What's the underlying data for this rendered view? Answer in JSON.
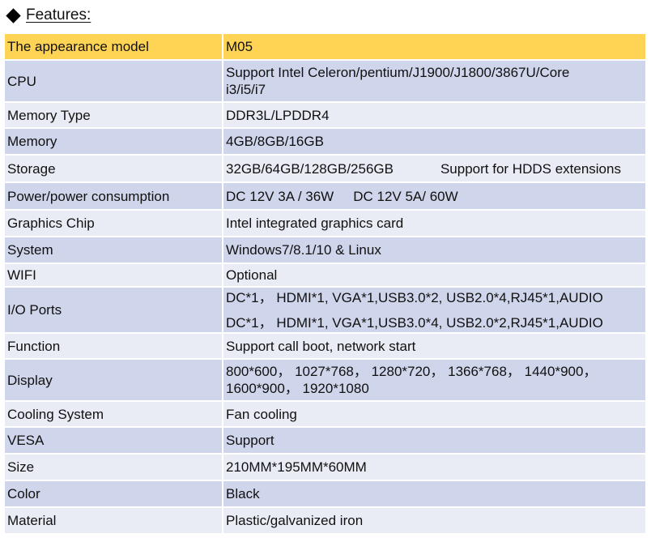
{
  "heading": "Features:",
  "rows": [
    {
      "label": "The appearance model",
      "value": "M05"
    },
    {
      "label": "CPU",
      "line1": "Support Intel Celeron/pentium/J1900/J1800/3867U/Core",
      "line2": "i3/i5/i7"
    },
    {
      "label": "Memory Type",
      "value": "DDR3L/LPDDR4"
    },
    {
      "label": "Memory",
      "value": "4GB/8GB/16GB"
    },
    {
      "label": "Storage",
      "part1": "32GB/64GB/128GB/256GB",
      "part2": "Support for HDDS extensions"
    },
    {
      "label": "Power/power consumption",
      "part1": "DC 12V 3A / 36W",
      "part2": "DC 12V 5A/ 60W"
    },
    {
      "label": "Graphics Chip",
      "value": "Intel integrated graphics card"
    },
    {
      "label": "System",
      "value": "Windows7/8.1/10 & Linux"
    },
    {
      "label": "WIFI",
      "value": "Optional"
    },
    {
      "label": "I/O Ports",
      "line1": "DC*1， HDMI*1, VGA*1,USB3.0*2, USB2.0*4,RJ45*1,AUDIO",
      "line2": "DC*1， HDMI*1, VGA*1,USB3.0*4, USB2.0*2,RJ45*1,AUDIO"
    },
    {
      "label": "Function",
      "value": "Support call boot, network start"
    },
    {
      "label": "Display",
      "line1": "800*600， 1027*768， 1280*720， 1366*768， 1440*900，",
      "line2": "1600*900， 1920*1080"
    },
    {
      "label": "Cooling System",
      "value": "Fan cooling"
    },
    {
      "label": "VESA",
      "value": "Support"
    },
    {
      "label": "Size",
      "value": "210MM*195MM*60MM"
    },
    {
      "label": "Color",
      "value": "Black"
    },
    {
      "label": "Material",
      "value": "Plastic/galvanized iron"
    }
  ]
}
